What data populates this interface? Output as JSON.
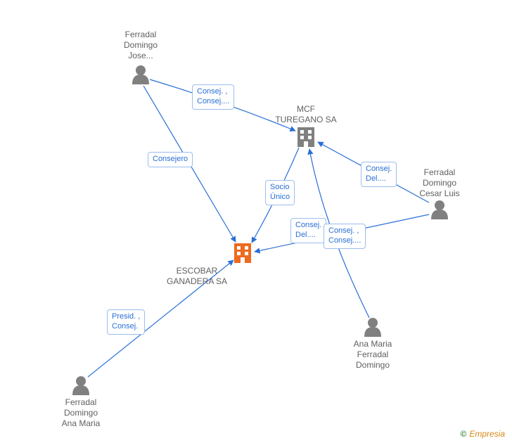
{
  "copyright": {
    "symbol": "©",
    "brand": "Empresia"
  },
  "nodes": {
    "jose": {
      "label_line1": "Ferradal",
      "label_line2": "Domingo",
      "label_line3": "Jose...",
      "type": "person"
    },
    "mcf": {
      "label_line1": "MCF",
      "label_line2": "TUREGANO SA",
      "label_line3": "",
      "type": "company"
    },
    "cesar": {
      "label_line1": "Ferradal",
      "label_line2": "Domingo",
      "label_line3": "Cesar Luis",
      "type": "person"
    },
    "escobar": {
      "label_line1": "ESCOBAR",
      "label_line2": "GANADERA SA",
      "label_line3": "",
      "type": "company_hl"
    },
    "anamariaFD": {
      "label_line1": "Ana Maria",
      "label_line2": "Ferradal",
      "label_line3": "Domingo",
      "type": "person"
    },
    "anamaria": {
      "label_line1": "Ferradal",
      "label_line2": "Domingo",
      "label_line3": "Ana Maria",
      "type": "person"
    }
  },
  "edges": {
    "jose_mcf": {
      "label_line1": "Consej. ,",
      "label_line2": "Consej...."
    },
    "jose_escobar": {
      "label_line1": "Consejero",
      "label_line2": ""
    },
    "mcf_escobar": {
      "label_line1": "Socio",
      "label_line2": "Único"
    },
    "cesar_mcf": {
      "label_line1": "Consej.",
      "label_line2": "Del...."
    },
    "cesar_escobar": {
      "label_line1": "Consej.",
      "label_line2": "Del...."
    },
    "anamariaFD_mcf": {
      "label_line1": "Consej. ,",
      "label_line2": "Consej...."
    },
    "anamaria_escobar": {
      "label_line1": "Presid. ,",
      "label_line2": "Consej."
    }
  }
}
